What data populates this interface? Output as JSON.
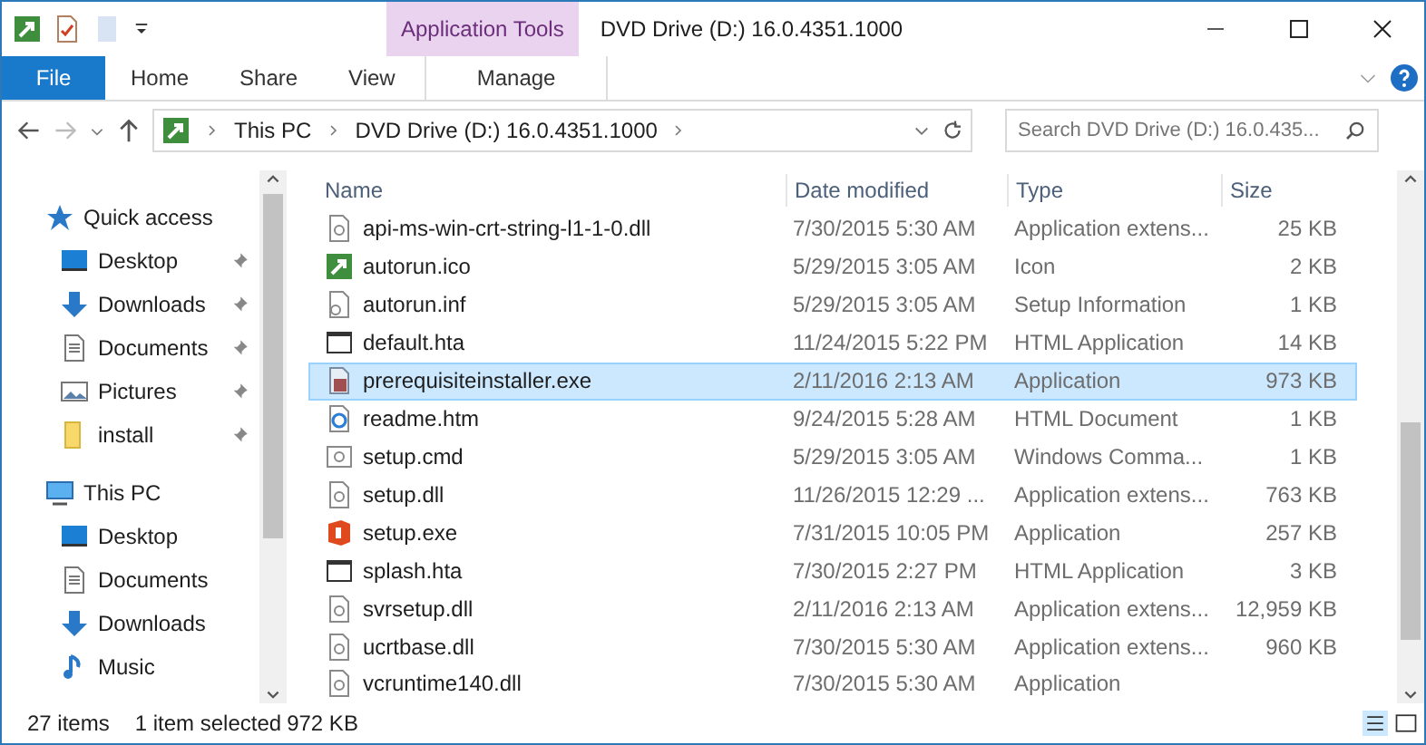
{
  "title_bar": {
    "contextual_tab": "Application Tools",
    "title": "DVD Drive (D:) 16.0.4351.1000"
  },
  "ribbon_tabs": [
    {
      "label": "File",
      "kind": "file"
    },
    {
      "label": "Home",
      "kind": "tab"
    },
    {
      "label": "Share",
      "kind": "tab"
    },
    {
      "label": "View",
      "kind": "tab"
    },
    {
      "label": "Manage",
      "kind": "contextual"
    }
  ],
  "address": {
    "breadcrumbs": [
      "This PC",
      "DVD Drive (D:) 16.0.4351.1000"
    ],
    "search": {
      "placeholder": "Search DVD Drive (D:) 16.0.435..."
    }
  },
  "navigation": [
    {
      "label": "Quick access",
      "kind": "star",
      "children": [
        {
          "label": "Desktop",
          "kind": "desktop",
          "pinned": true
        },
        {
          "label": "Downloads",
          "kind": "downloads",
          "pinned": true
        },
        {
          "label": "Documents",
          "kind": "documents",
          "pinned": true
        },
        {
          "label": "Pictures",
          "kind": "pictures",
          "pinned": true
        },
        {
          "label": "install",
          "kind": "folder",
          "pinned": true
        }
      ]
    },
    {
      "label": "This PC",
      "kind": "pc",
      "children": [
        {
          "label": "Desktop",
          "kind": "desktop",
          "pinned": false
        },
        {
          "label": "Documents",
          "kind": "documents",
          "pinned": false
        },
        {
          "label": "Downloads",
          "kind": "downloads",
          "pinned": false
        },
        {
          "label": "Music",
          "kind": "music",
          "pinned": false
        }
      ]
    }
  ],
  "file_list": {
    "columns": [
      "Name",
      "Date modified",
      "Type",
      "Size"
    ],
    "rows": [
      {
        "name": "api-ms-win-crt-string-l1-1-0.dll",
        "date": "7/30/2015 5:30 AM",
        "type": "Application extens...",
        "size": "25 KB",
        "kind": "dll",
        "selected": false
      },
      {
        "name": "autorun.ico",
        "date": "5/29/2015 3:05 AM",
        "type": "Icon",
        "size": "2 KB",
        "kind": "ico",
        "selected": false
      },
      {
        "name": "autorun.inf",
        "date": "5/29/2015 3:05 AM",
        "type": "Setup Information",
        "size": "1 KB",
        "kind": "inf",
        "selected": false
      },
      {
        "name": "default.hta",
        "date": "11/24/2015 5:22 PM",
        "type": "HTML Application",
        "size": "14 KB",
        "kind": "hta",
        "selected": false
      },
      {
        "name": "prerequisiteinstaller.exe",
        "date": "2/11/2016 2:13 AM",
        "type": "Application",
        "size": "973 KB",
        "kind": "installer",
        "selected": true
      },
      {
        "name": "readme.htm",
        "date": "9/24/2015 5:28 AM",
        "type": "HTML Document",
        "size": "1 KB",
        "kind": "htm",
        "selected": false
      },
      {
        "name": "setup.cmd",
        "date": "5/29/2015 3:05 AM",
        "type": "Windows Comma...",
        "size": "1 KB",
        "kind": "cmd",
        "selected": false
      },
      {
        "name": "setup.dll",
        "date": "11/26/2015 12:29 ...",
        "type": "Application extens...",
        "size": "763 KB",
        "kind": "dll",
        "selected": false
      },
      {
        "name": "setup.exe",
        "date": "7/31/2015 10:05 PM",
        "type": "Application",
        "size": "257 KB",
        "kind": "office",
        "selected": false
      },
      {
        "name": "splash.hta",
        "date": "7/30/2015 2:27 PM",
        "type": "HTML Application",
        "size": "3 KB",
        "kind": "hta",
        "selected": false
      },
      {
        "name": "svrsetup.dll",
        "date": "2/11/2016 2:13 AM",
        "type": "Application extens...",
        "size": "12,959 KB",
        "kind": "dll",
        "selected": false
      },
      {
        "name": "ucrtbase.dll",
        "date": "7/30/2015 5:30 AM",
        "type": "Application extens...",
        "size": "960 KB",
        "kind": "dll",
        "selected": false
      },
      {
        "name": "vcruntime140.dll",
        "date": "7/30/2015 5:30 AM",
        "type": "Application",
        "size": "",
        "kind": "dll",
        "selected": false
      }
    ]
  },
  "status_bar": {
    "item_count": "27 items",
    "selection": "1 item selected",
    "selection_size": "972 KB"
  }
}
